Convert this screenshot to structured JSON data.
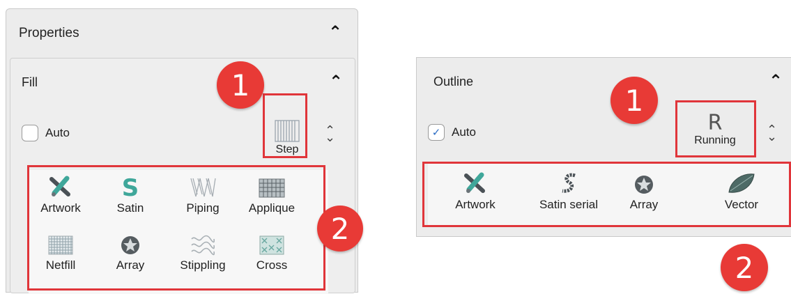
{
  "left": {
    "properties_title": "Properties",
    "fill_title": "Fill",
    "auto_label": "Auto",
    "current_mode": {
      "label": "Step",
      "icon": "step-icon"
    },
    "badge1": "1",
    "badge2": "2",
    "options": [
      {
        "label": "Artwork",
        "icon": "artwork-icon"
      },
      {
        "label": "Satin",
        "icon": "satin-icon"
      },
      {
        "label": "Piping",
        "icon": "piping-icon"
      },
      {
        "label": "Applique",
        "icon": "applique-icon"
      },
      {
        "label": "Netfill",
        "icon": "netfill-icon"
      },
      {
        "label": "Array",
        "icon": "array-icon"
      },
      {
        "label": "Stippling",
        "icon": "stippling-icon"
      },
      {
        "label": "Cross",
        "icon": "cross-icon"
      }
    ]
  },
  "right": {
    "outline_title": "Outline",
    "auto_label": "Auto",
    "auto_checked": true,
    "current_mode": {
      "label": "Running",
      "glyph": "R",
      "icon": "running-icon"
    },
    "badge1": "1",
    "badge2": "2",
    "options": [
      {
        "label": "Artwork",
        "icon": "artwork-icon"
      },
      {
        "label": "Satin serial",
        "icon": "satin-serial-icon"
      },
      {
        "label": "Array",
        "icon": "array-icon"
      },
      {
        "label": "Vector",
        "icon": "vector-icon"
      }
    ]
  },
  "colors": {
    "highlight": "#e0353a",
    "badge": "#e83a36",
    "icon_teal": "#3fa79a"
  }
}
